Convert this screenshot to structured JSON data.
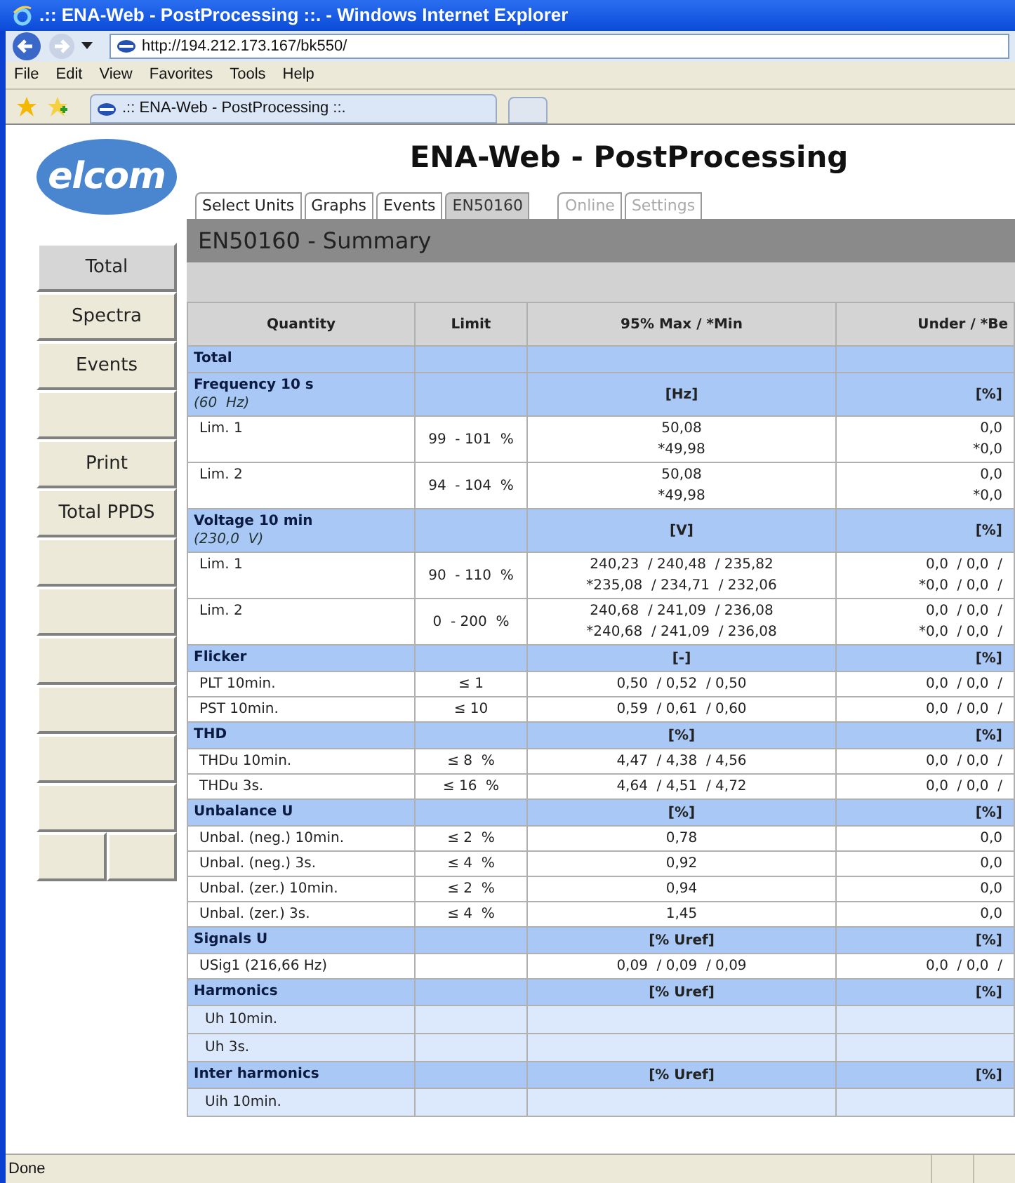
{
  "window": {
    "title": ".:: ENA-Web - PostProcessing ::. - Windows Internet Explorer"
  },
  "address": "http://194.212.173.167/bk550/",
  "menu": [
    "File",
    "Edit",
    "View",
    "Favorites",
    "Tools",
    "Help"
  ],
  "browser_tab": ".:: ENA-Web - PostProcessing ::.",
  "heading": "ENA-Web - PostProcessing",
  "logo": "elcom",
  "tabs": [
    {
      "label": "Select Units",
      "selected": false,
      "disabled": false
    },
    {
      "label": "Graphs",
      "selected": false,
      "disabled": false
    },
    {
      "label": "Events",
      "selected": false,
      "disabled": false
    },
    {
      "label": "EN50160",
      "selected": true,
      "disabled": false
    },
    {
      "label": "Online",
      "selected": false,
      "disabled": true
    },
    {
      "label": "Settings",
      "selected": false,
      "disabled": true
    }
  ],
  "sidebar": [
    {
      "kind": "button",
      "label": "Total",
      "selected": true
    },
    {
      "kind": "button",
      "label": "Spectra",
      "selected": false
    },
    {
      "kind": "button",
      "label": "Events",
      "selected": false
    },
    {
      "kind": "blank",
      "selected": false
    },
    {
      "kind": "button",
      "label": "Print",
      "selected": false
    },
    {
      "kind": "button",
      "label": "Total PPDS",
      "selected": false
    },
    {
      "kind": "blank",
      "selected": false
    },
    {
      "kind": "blank",
      "selected": false
    },
    {
      "kind": "blank",
      "selected": false
    },
    {
      "kind": "blank",
      "selected": false
    },
    {
      "kind": "blank",
      "selected": false
    },
    {
      "kind": "blank",
      "selected": false
    },
    {
      "kind": "split"
    }
  ],
  "panel_title": "EN50160 - Summary",
  "table": {
    "columns": [
      "Quantity",
      "Limit",
      "95% Max / *Min",
      "Under / *Be"
    ],
    "rows": [
      {
        "kind": "section",
        "name": "Total"
      },
      {
        "kind": "section",
        "name": "Frequency 10 s",
        "note": "(60  Hz)",
        "unit": "[Hz]",
        "unit2": "[%]"
      },
      {
        "kind": "data",
        "name": "Lim. 1",
        "limit": "99  - 101  %",
        "value": [
          "50,08",
          "*49,98"
        ],
        "under": [
          "0,0",
          "*0,0"
        ]
      },
      {
        "kind": "data",
        "name": "Lim. 2",
        "limit": "94  - 104  %",
        "value": [
          "50,08",
          "*49,98"
        ],
        "under": [
          "0,0",
          "*0,0"
        ]
      },
      {
        "kind": "section",
        "name": "Voltage 10 min",
        "note": "(230,0  V)",
        "unit": "[V]",
        "unit2": "[%]"
      },
      {
        "kind": "data",
        "name": "Lim. 1",
        "limit": "90  - 110  %",
        "value": [
          "240,23  / 240,48  / 235,82",
          "*235,08  / 234,71  / 232,06"
        ],
        "under": [
          "0,0  / 0,0  /",
          "*0,0  / 0,0  /"
        ]
      },
      {
        "kind": "data",
        "name": "Lim. 2",
        "limit": "0  - 200  %",
        "value": [
          "240,68  / 241,09  / 236,08",
          "*240,68  / 241,09  / 236,08"
        ],
        "under": [
          "0,0  / 0,0  /",
          "*0,0  / 0,0  /"
        ]
      },
      {
        "kind": "section",
        "name": "Flicker",
        "unit": "[-]",
        "unit2": "[%]"
      },
      {
        "kind": "data",
        "name": "PLT 10min.",
        "limit": "≤ 1",
        "value": [
          "0,50  / 0,52  / 0,50"
        ],
        "under": [
          "0,0  / 0,0  /"
        ]
      },
      {
        "kind": "data",
        "name": "PST 10min.",
        "limit": "≤ 10",
        "value": [
          "0,59  / 0,61  / 0,60"
        ],
        "under": [
          "0,0  / 0,0  /"
        ]
      },
      {
        "kind": "section",
        "name": "THD",
        "unit": "[%]",
        "unit2": "[%]"
      },
      {
        "kind": "data",
        "name": "THDu 10min.",
        "limit": "≤ 8  %",
        "value": [
          "4,47  / 4,38  / 4,56"
        ],
        "under": [
          "0,0  / 0,0  /"
        ]
      },
      {
        "kind": "data",
        "name": "THDu 3s.",
        "limit": "≤ 16  %",
        "value": [
          "4,64  / 4,51  / 4,72"
        ],
        "under": [
          "0,0  / 0,0  /"
        ]
      },
      {
        "kind": "section",
        "name": "Unbalance U",
        "unit": "[%]",
        "unit2": "[%]"
      },
      {
        "kind": "data",
        "name": "Unbal. (neg.) 10min.",
        "limit": "≤ 2  %",
        "value": [
          "0,78"
        ],
        "under": [
          "0,0"
        ]
      },
      {
        "kind": "data",
        "name": "Unbal. (neg.) 3s.",
        "limit": "≤ 4  %",
        "value": [
          "0,92"
        ],
        "under": [
          "0,0"
        ]
      },
      {
        "kind": "data",
        "name": "Unbal. (zer.) 10min.",
        "limit": "≤ 2  %",
        "value": [
          "0,94"
        ],
        "under": [
          "0,0"
        ]
      },
      {
        "kind": "data",
        "name": "Unbal. (zer.) 3s.",
        "limit": "≤ 4  %",
        "value": [
          "1,45"
        ],
        "under": [
          "0,0"
        ]
      },
      {
        "kind": "section",
        "name": "Signals U",
        "unit": "[% Uref]",
        "unit2": "[%]"
      },
      {
        "kind": "data",
        "name": "USig1 (216,66  Hz)",
        "value": [
          "0,09  / 0,09  / 0,09"
        ],
        "under": [
          "0,0  / 0,0  /"
        ]
      },
      {
        "kind": "section",
        "name": "Harmonics",
        "unit": "[% Uref]",
        "unit2": "[%]"
      },
      {
        "kind": "sub",
        "name": "Uh 10min."
      },
      {
        "kind": "sub",
        "name": "Uh 3s."
      },
      {
        "kind": "section",
        "name": "Inter harmonics",
        "unit": "[% Uref]",
        "unit2": "[%]"
      },
      {
        "kind": "sub",
        "name": "Uih 10min."
      }
    ]
  },
  "status_bar": "Done"
}
